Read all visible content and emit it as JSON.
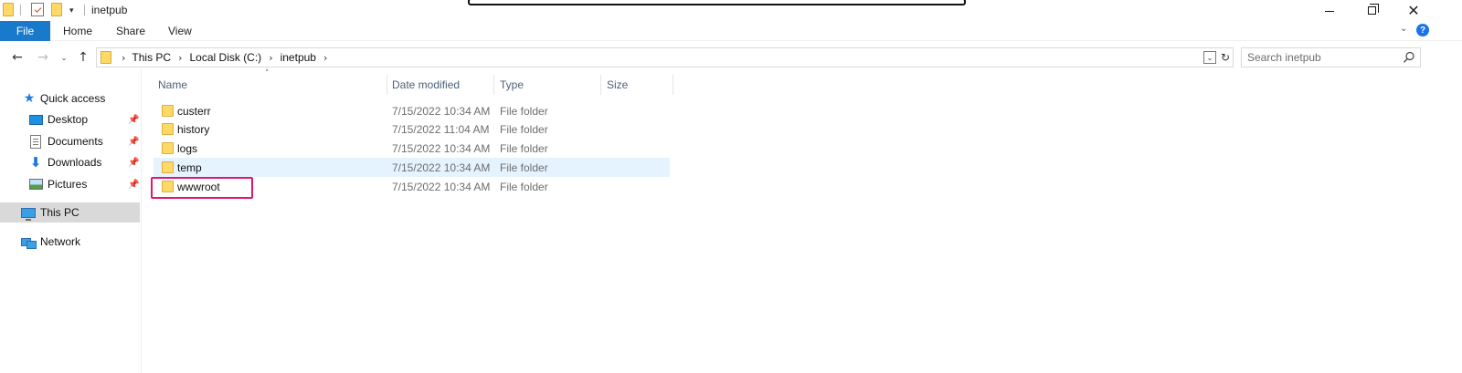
{
  "titlebar": {
    "title": "inetpub",
    "icons": [
      "folder-icon",
      "properties-icon",
      "new-folder-icon",
      "chevron-down-icon"
    ],
    "window_buttons": [
      "minimize-icon",
      "maximize-icon",
      "close-icon"
    ],
    "close_glyph": "✕"
  },
  "ribbon": {
    "tabs": [
      {
        "label": "File"
      },
      {
        "label": "Home"
      },
      {
        "label": "Share"
      },
      {
        "label": "View"
      }
    ],
    "file_tab_color": "#1979ca",
    "help_glyph": "?"
  },
  "navigation": {
    "back_glyph": "←",
    "forward_glyph": "→",
    "recent_glyph": "⌄",
    "up_glyph": "↑",
    "breadcrumbs": [
      "This PC",
      "Local Disk (C:)",
      "inetpub"
    ],
    "search_placeholder": "Search inetpub"
  },
  "sidebar": {
    "items": [
      {
        "label": "Quick access",
        "icon": "star-icon"
      },
      {
        "label": "Desktop",
        "icon": "desktop-icon",
        "pinned": true
      },
      {
        "label": "Documents",
        "icon": "documents-icon",
        "pinned": true
      },
      {
        "label": "Downloads",
        "icon": "downloads-icon",
        "pinned": true
      },
      {
        "label": "Pictures",
        "icon": "pictures-icon",
        "pinned": true
      },
      {
        "label": "This PC",
        "icon": "computer-icon",
        "selected": true
      },
      {
        "label": "Network",
        "icon": "network-icon"
      }
    ],
    "selected_bg": "#d9d9d9"
  },
  "file_list": {
    "columns": [
      "Name",
      "Date modified",
      "Type",
      "Size"
    ],
    "rows": [
      {
        "name": "custerr",
        "date": "7/15/2022 10:34 AM",
        "type": "File folder"
      },
      {
        "name": "history",
        "date": "7/15/2022 11:04 AM",
        "type": "File folder"
      },
      {
        "name": "logs",
        "date": "7/15/2022 10:34 AM",
        "type": "File folder"
      },
      {
        "name": "temp",
        "date": "7/15/2022 10:34 AM",
        "type": "File folder",
        "hovered": true
      },
      {
        "name": "wwwroot",
        "date": "7/15/2022 10:34 AM",
        "type": "File folder",
        "annotated": true
      }
    ],
    "hover_color": "#e5f3ff",
    "annotation_color": "#e0186c",
    "folder_color": "#ffd965"
  }
}
